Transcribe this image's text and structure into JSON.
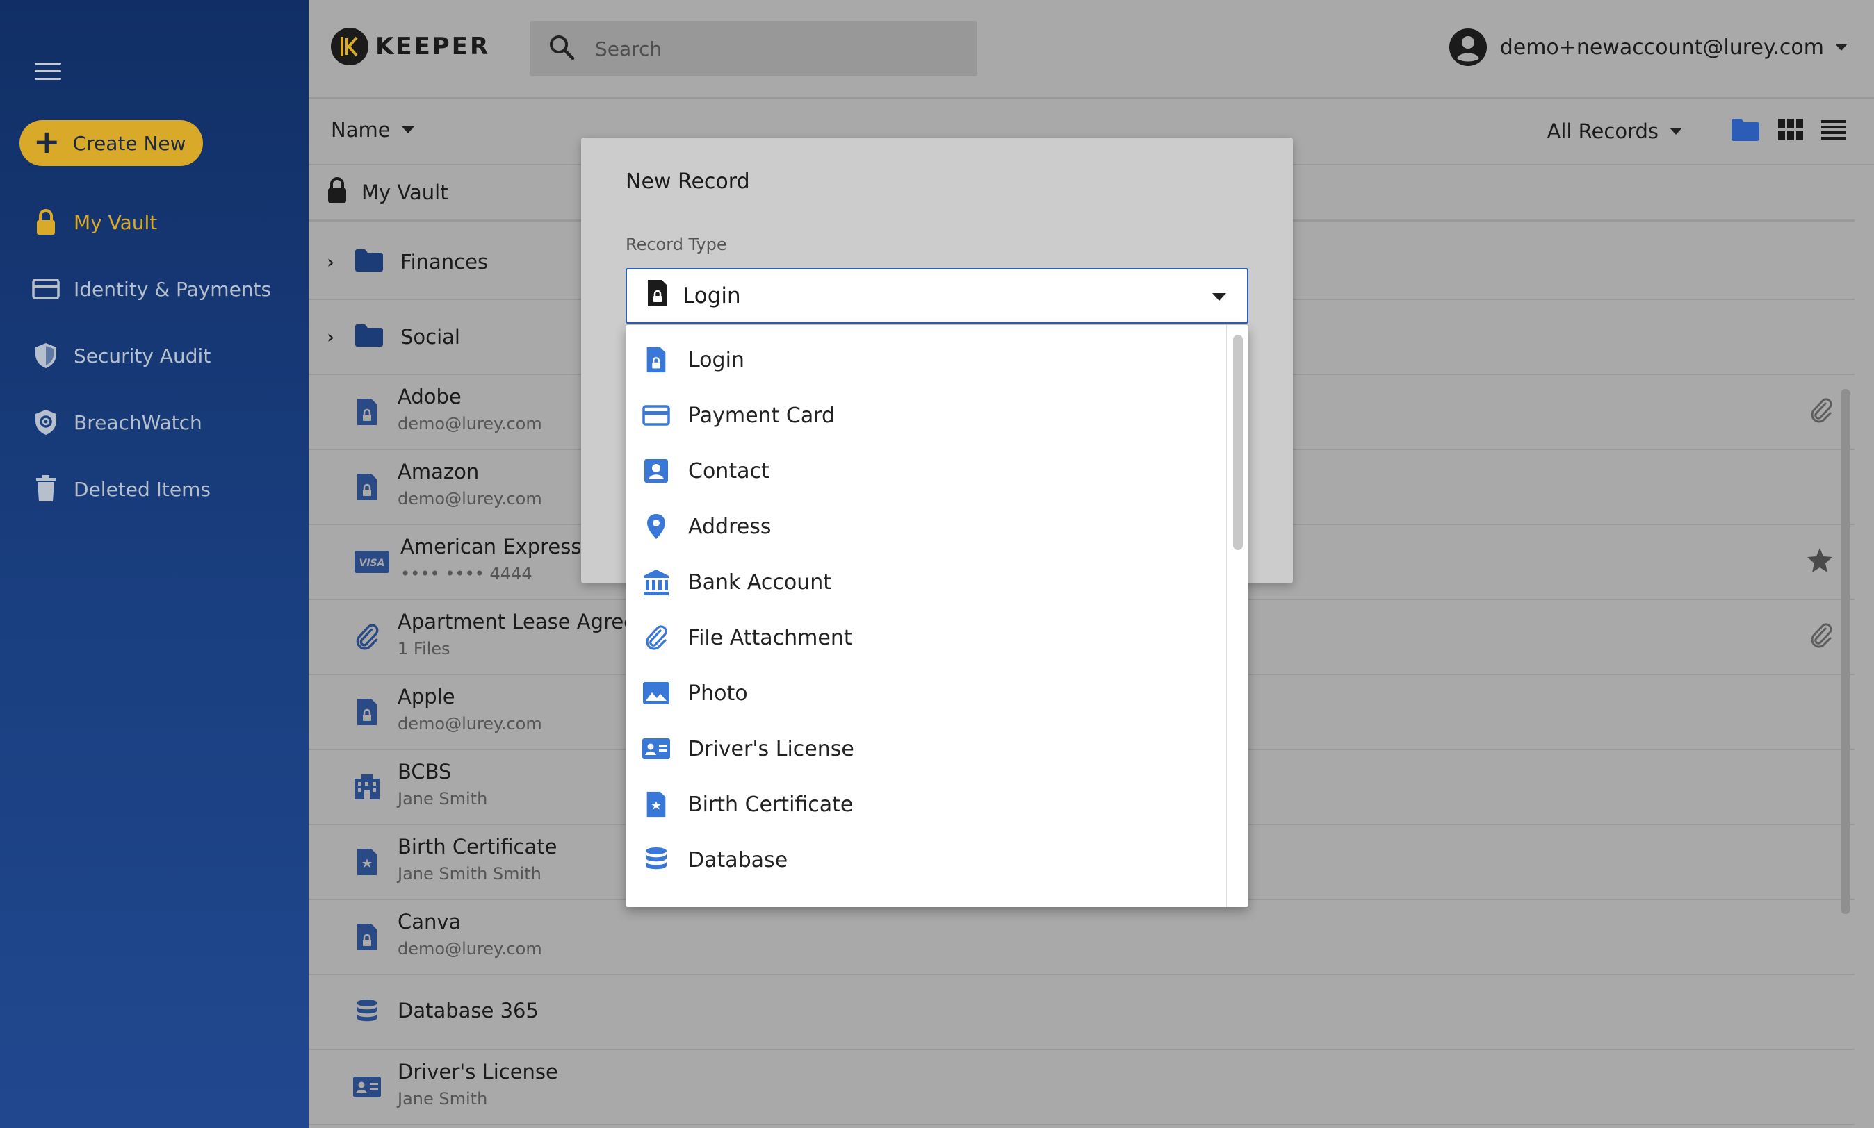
{
  "sidebar": {
    "create_label": "Create New",
    "items": [
      {
        "label": "My Vault",
        "icon": "lock-icon",
        "active": true
      },
      {
        "label": "Identity & Payments",
        "icon": "card-icon"
      },
      {
        "label": "Security Audit",
        "icon": "shield-icon"
      },
      {
        "label": "BreachWatch",
        "icon": "breachwatch-icon"
      },
      {
        "label": "Deleted Items",
        "icon": "trash-icon"
      }
    ]
  },
  "header": {
    "logo_text": "KEEPER",
    "search_placeholder": "Search",
    "account_email": "demo+newaccount@lurey.com"
  },
  "toolbar": {
    "sort_label": "Name",
    "filter_label": "All Records"
  },
  "list": {
    "vault_label": "My Vault",
    "folders": [
      {
        "label": "Finances"
      },
      {
        "label": "Social"
      }
    ],
    "records": [
      {
        "title": "Adobe",
        "subtitle": "demo@lurey.com",
        "icon": "login-record-icon",
        "right": "paperclip-icon"
      },
      {
        "title": "Amazon",
        "subtitle": "demo@lurey.com",
        "icon": "login-record-icon"
      },
      {
        "title": "American Express",
        "subtitle": "•••• •••• 4444",
        "icon": "visa-icon",
        "right": "star-icon"
      },
      {
        "title": "Apartment Lease Agreement",
        "subtitle": "1 Files",
        "icon": "paperclip-icon",
        "right": "paperclip-icon"
      },
      {
        "title": "Apple",
        "subtitle": "demo@lurey.com",
        "icon": "login-record-icon"
      },
      {
        "title": "BCBS",
        "subtitle": "Jane Smith",
        "icon": "building-icon"
      },
      {
        "title": "Birth Certificate",
        "subtitle": "Jane Smith Smith",
        "icon": "certificate-icon"
      },
      {
        "title": "Canva",
        "subtitle": "demo@lurey.com",
        "icon": "login-record-icon"
      },
      {
        "title": "Database 365",
        "subtitle": "",
        "icon": "database-icon"
      },
      {
        "title": "Driver's License",
        "subtitle": "Jane Smith",
        "icon": "id-card-icon"
      }
    ],
    "visa_text": "VISA"
  },
  "modal": {
    "title": "New Record",
    "field_label": "Record Type",
    "selected_value": "Login",
    "options": [
      {
        "label": "Login",
        "icon": "login-record-icon"
      },
      {
        "label": "Payment Card",
        "icon": "card-icon"
      },
      {
        "label": "Contact",
        "icon": "contact-icon"
      },
      {
        "label": "Address",
        "icon": "location-pin-icon"
      },
      {
        "label": "Bank Account",
        "icon": "bank-icon"
      },
      {
        "label": "File Attachment",
        "icon": "paperclip-icon"
      },
      {
        "label": "Photo",
        "icon": "photo-icon"
      },
      {
        "label": "Driver's License",
        "icon": "id-card-icon"
      },
      {
        "label": "Birth Certificate",
        "icon": "certificate-icon"
      },
      {
        "label": "Database",
        "icon": "database-icon"
      }
    ]
  },
  "colors": {
    "sidebar_top": "#112f66",
    "accent_gold": "#d9a92a",
    "menu_icon_blue": "#3a78d8",
    "list_icon_navy": "#2a4a86"
  }
}
